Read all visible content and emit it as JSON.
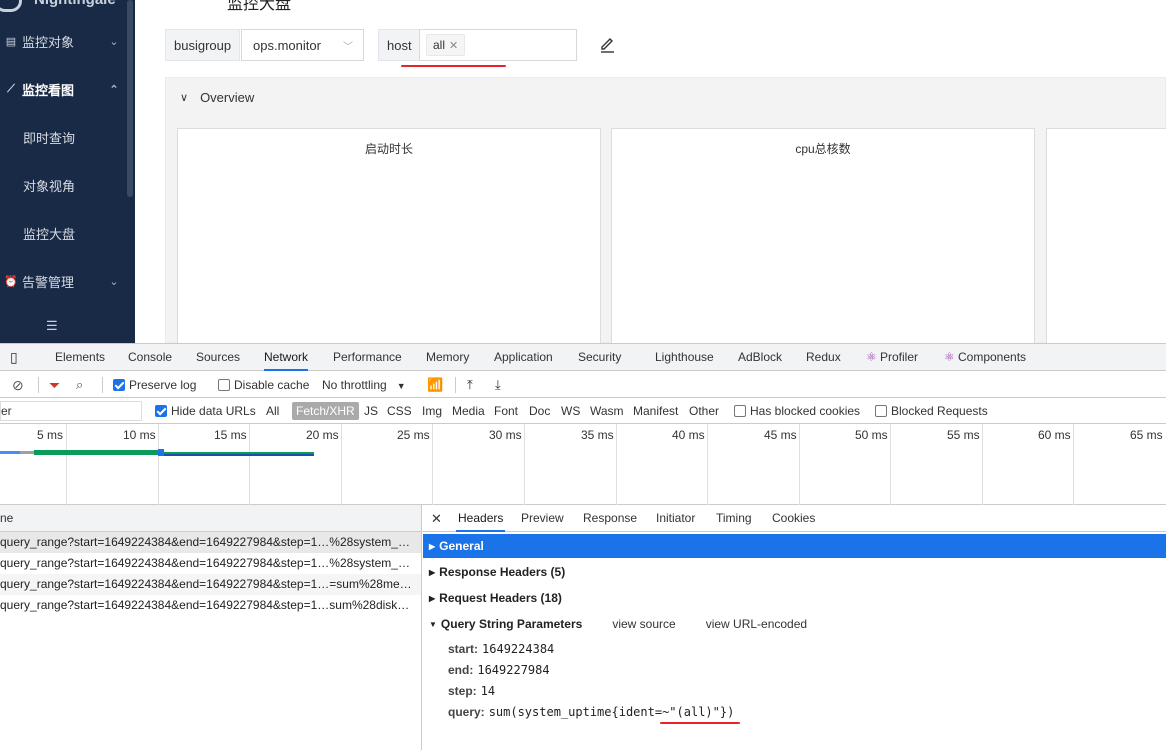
{
  "sidebar": {
    "logo_text": "Nightingale",
    "items": [
      {
        "label": "监控对象",
        "icon": "list-icon",
        "expanded": false
      },
      {
        "label": "监控看图",
        "icon": "chart-icon",
        "expanded": true
      },
      {
        "label": "即时查询"
      },
      {
        "label": "对象视角"
      },
      {
        "label": "监控大盘"
      },
      {
        "label": "告警管理",
        "icon": "alarm-icon",
        "expanded": false
      }
    ],
    "collapse_icon": "menu-fold-icon"
  },
  "header": {
    "breadcrumb": "监控大盘"
  },
  "filters": {
    "busigroup_label": "busigroup",
    "busigroup_value": "ops.monitor",
    "host_label": "host",
    "host_tag": "all",
    "highlight_color": "#e5242a"
  },
  "overview": {
    "title": "Overview",
    "panels": [
      "启动时长",
      "cpu总核数"
    ]
  },
  "devtools": {
    "tabs": [
      "Elements",
      "Console",
      "Sources",
      "Network",
      "Performance",
      "Memory",
      "Application",
      "Security",
      "Lighthouse",
      "AdBlock",
      "Redux",
      "Profiler",
      "Components"
    ],
    "active_tab": "Network",
    "toolbar": {
      "preserve_log": "Preserve log",
      "disable_cache": "Disable cache",
      "throttling": "No throttling"
    },
    "filterbar": {
      "filter_value": "er",
      "hide_data_urls": "Hide data URLs",
      "types": [
        "All",
        "Fetch/XHR",
        "JS",
        "CSS",
        "Img",
        "Media",
        "Font",
        "Doc",
        "WS",
        "Wasm",
        "Manifest",
        "Other"
      ],
      "active_type": "Fetch/XHR",
      "has_blocked_cookies": "Has blocked cookies",
      "blocked_requests": "Blocked Requests"
    },
    "timeline_ticks": [
      "5 ms",
      "10 ms",
      "15 ms",
      "20 ms",
      "25 ms",
      "30 ms",
      "35 ms",
      "40 ms",
      "45 ms",
      "50 ms",
      "55 ms",
      "60 ms",
      "65 ms"
    ],
    "requests_header": "ne",
    "requests": [
      "query_range?start=1649224384&end=1649227984&step=1…%28system_…",
      "query_range?start=1649224384&end=1649227984&step=1…%28system_…",
      "query_range?start=1649224384&end=1649227984&step=1…=sum%28me…",
      "query_range?start=1649224384&end=1649227984&step=1…sum%28disk…"
    ],
    "detail_tabs": [
      "Headers",
      "Preview",
      "Response",
      "Initiator",
      "Timing",
      "Cookies"
    ],
    "active_detail_tab": "Headers",
    "sections": {
      "general": "General",
      "response_headers": "Response Headers (5)",
      "request_headers": "Request Headers (18)",
      "query_string": "Query String Parameters",
      "view_source": "view source",
      "view_url_encoded": "view URL-encoded"
    },
    "params": [
      {
        "key": "start:",
        "value": "1649224384"
      },
      {
        "key": "end:",
        "value": "1649227984"
      },
      {
        "key": "step:",
        "value": "14"
      },
      {
        "key": "query:",
        "value": "sum(system_uptime{ident=~\"(all)\"})"
      }
    ]
  }
}
